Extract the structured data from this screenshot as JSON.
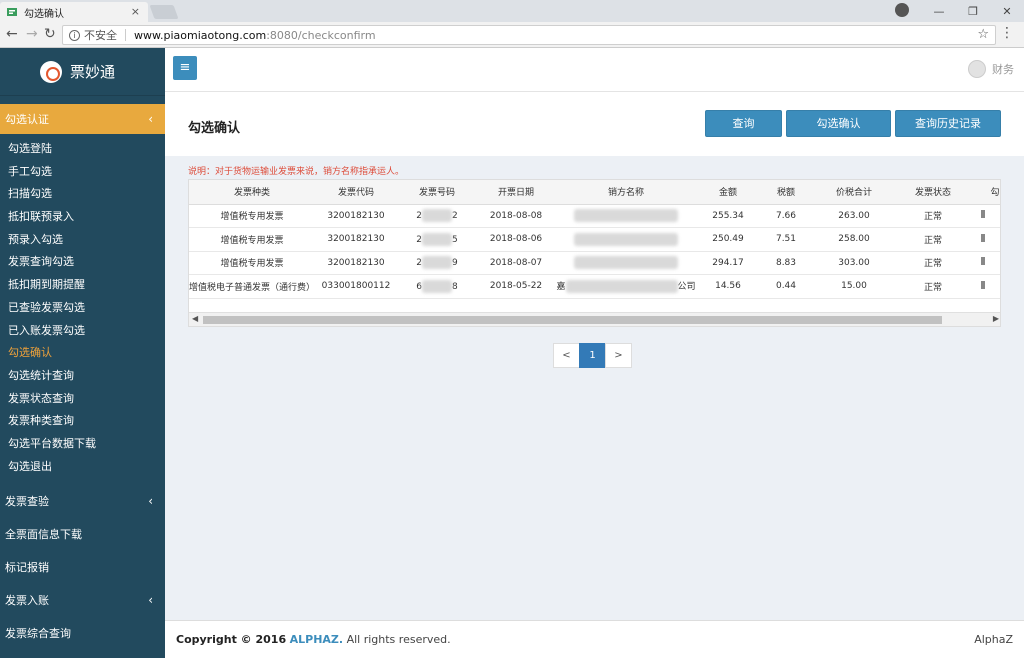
{
  "browser": {
    "tab_title": "勾选确认",
    "tab_close": "×",
    "insecure_label": "不安全",
    "url_host": "www.piaomiaotong.com",
    "url_path": ":8080/checkconfirm",
    "win_minimize": "—",
    "win_restore": "❐",
    "win_close": "✕"
  },
  "brand": {
    "name": "票妙通"
  },
  "sidebar": {
    "groups": [
      {
        "label": "勾选认证",
        "active": true,
        "items": [
          "勾选登陆",
          "手工勾选",
          "扫描勾选",
          "抵扣联预录入",
          "预录入勾选",
          "发票查询勾选",
          "抵扣期到期提醒",
          "已查验发票勾选",
          "已入账发票勾选",
          "勾选确认",
          "勾选统计查询",
          "发票状态查询",
          "发票种类查询",
          "勾选平台数据下载",
          "勾选退出"
        ],
        "current": "勾选确认"
      },
      {
        "label": "发票查验"
      },
      {
        "label": "全票面信息下载"
      },
      {
        "label": "标记报销"
      },
      {
        "label": "发票入账"
      },
      {
        "label": "发票综合查询"
      }
    ]
  },
  "header": {
    "user_name": "财务"
  },
  "page": {
    "title": "勾选确认",
    "buttons": {
      "query": "查询",
      "confirm": "勾选确认",
      "history": "查询历史记录"
    },
    "note": "说明：对于货物运输业发票来说，销方名称指承运人。"
  },
  "table": {
    "columns": [
      "发票种类",
      "发票代码",
      "发票号码",
      "开票日期",
      "销方名称",
      "金额",
      "税额",
      "价税合计",
      "发票状态",
      "勾"
    ],
    "rows": [
      {
        "type": "增值税专用发票",
        "code": "3200182130",
        "num_a": "2",
        "num_b": "2",
        "date": "2018-08-08",
        "seller_a": "",
        "seller_b": "",
        "amount": "255.34",
        "tax": "7.66",
        "total": "263.00",
        "status": "正常"
      },
      {
        "type": "增值税专用发票",
        "code": "3200182130",
        "num_a": "2",
        "num_b": "5",
        "date": "2018-08-06",
        "seller_a": "",
        "seller_b": "",
        "amount": "250.49",
        "tax": "7.51",
        "total": "258.00",
        "status": "正常"
      },
      {
        "type": "增值税专用发票",
        "code": "3200182130",
        "num_a": "2",
        "num_b": "9",
        "date": "2018-08-07",
        "seller_a": "",
        "seller_b": "",
        "amount": "294.17",
        "tax": "8.83",
        "total": "303.00",
        "status": "正常"
      },
      {
        "type": "增值税电子普通发票（通行费）",
        "code": "033001800112",
        "num_a": "6",
        "num_b": "8",
        "date": "2018-05-22",
        "seller_a": "嘉",
        "seller_b": "公司",
        "amount": "14.56",
        "tax": "0.44",
        "total": "15.00",
        "status": "正常"
      }
    ]
  },
  "pagination": {
    "prev": "<",
    "current": "1",
    "next": ">"
  },
  "footer": {
    "copyright_prefix": "Copyright © 2016",
    "company": "ALPHAZ.",
    "rights": "All rights reserved.",
    "right_text": "AlphaZ"
  },
  "colors": {
    "sidebar": "#224a5e",
    "accent": "#e8a93e",
    "primary": "#3c8dbc"
  }
}
